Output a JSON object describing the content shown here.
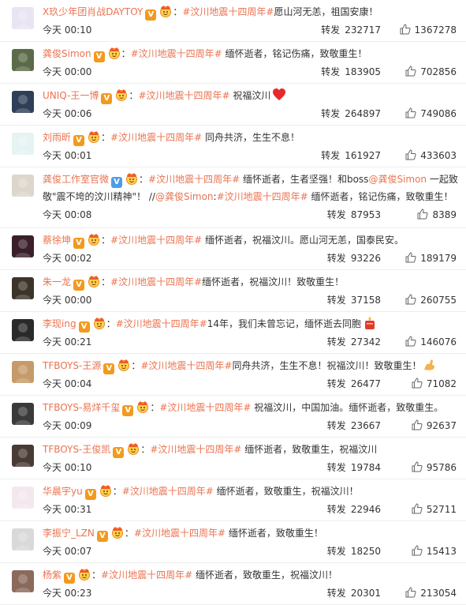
{
  "labels": {
    "repost": "转发"
  },
  "posts": [
    {
      "username": "X玖少年团肖战DAYTOY",
      "verified": "orange",
      "crown": true,
      "colon": "：",
      "lines": [
        [
          {
            "t": "tag",
            "v": "#汶川地震十四周年#"
          },
          {
            "t": "txt",
            "v": "愿山河无恙，祖国安康！"
          }
        ]
      ],
      "time": "今天 00:10",
      "reposts": "232717",
      "likes": "1367278",
      "avatar_color": "#e9e4f2"
    },
    {
      "username": "龚俊Simon",
      "verified": "orange",
      "crown": true,
      "colon": "：",
      "lines": [
        [
          {
            "t": "tag",
            "v": "#汶川地震十四周年#"
          },
          {
            "t": "txt",
            "v": " 缅怀逝者，铭记伤痛，致敬重生！"
          }
        ]
      ],
      "time": "今天 00:00",
      "reposts": "183905",
      "likes": "702856",
      "avatar_color": "#5b6b4a"
    },
    {
      "username": "UNIQ-王一博",
      "verified": "orange",
      "crown": true,
      "colon": "：",
      "lines": [
        [
          {
            "t": "tag",
            "v": "#汶川地震十四周年#"
          },
          {
            "t": "txt",
            "v": " 祝福汶川"
          },
          {
            "t": "emoji",
            "v": "red-heart-icon"
          }
        ]
      ],
      "time": "今天 00:06",
      "reposts": "264897",
      "likes": "749086",
      "avatar_color": "#2f3f58"
    },
    {
      "username": "刘雨昕",
      "verified": "orange",
      "crown": true,
      "colon": "：",
      "lines": [
        [
          {
            "t": "tag",
            "v": "#汶川地震十四周年#"
          },
          {
            "t": "txt",
            "v": " 同舟共济，生生不息！"
          }
        ]
      ],
      "time": "今天 00:01",
      "reposts": "161927",
      "likes": "433603",
      "avatar_color": "#e6f3f3"
    },
    {
      "username": "龚俊工作室官微",
      "verified": "blue",
      "crown": true,
      "colon": "：",
      "lines": [
        [
          {
            "t": "tag",
            "v": "#汶川地震十四周年#"
          },
          {
            "t": "txt",
            "v": " 缅怀逝者，生者坚强！和boss"
          },
          {
            "t": "mention",
            "v": "@龚俊Simon"
          },
          {
            "t": "txt",
            "v": " 一起致"
          }
        ],
        [
          {
            "t": "txt",
            "v": "敬\"震不垮的汶川精神\"！ //"
          },
          {
            "t": "mention",
            "v": "@龚俊Simon"
          },
          {
            "t": "txt",
            "v": ":"
          },
          {
            "t": "tag",
            "v": "#汶川地震十四周年#"
          },
          {
            "t": "txt",
            "v": " 缅怀逝者，铭记伤痛，致敬重生！"
          }
        ]
      ],
      "time": "今天 00:08",
      "reposts": "87953",
      "likes": "8389",
      "avatar_color": "#ddd6cc"
    },
    {
      "username": "蔡徐坤",
      "verified": "orange",
      "crown": true,
      "colon": "：",
      "lines": [
        [
          {
            "t": "tag",
            "v": "#汶川地震十四周年#"
          },
          {
            "t": "txt",
            "v": " 缅怀逝者，祝福汶川。愿山河无恙，国泰民安。"
          }
        ]
      ],
      "time": "今天 00:02",
      "reposts": "93226",
      "likes": "189179",
      "avatar_color": "#3b1f2a"
    },
    {
      "username": "朱一龙",
      "verified": "orange",
      "crown": true,
      "colon": "：",
      "lines": [
        [
          {
            "t": "tag",
            "v": "#汶川地震十四周年#"
          },
          {
            "t": "txt",
            "v": "缅怀逝者，祝福汶川！致敬重生！"
          }
        ]
      ],
      "time": "今天 00:00",
      "reposts": "37158",
      "likes": "260755",
      "avatar_color": "#3c3428"
    },
    {
      "username": "李现ing",
      "verified": "orange",
      "crown": true,
      "colon": "：",
      "lines": [
        [
          {
            "t": "tag",
            "v": "#汶川地震十四周年#"
          },
          {
            "t": "txt",
            "v": "14年，我们未曾忘记，缅怀逝去同胞"
          },
          {
            "t": "emoji",
            "v": "candle-icon"
          }
        ]
      ],
      "time": "今天 00:21",
      "reposts": "27342",
      "likes": "146076",
      "avatar_color": "#2a2a2a"
    },
    {
      "username": "TFBOYS-王源",
      "verified": "orange",
      "crown": true,
      "colon": "：",
      "lines": [
        [
          {
            "t": "tag",
            "v": "#汶川地震十四周年#"
          },
          {
            "t": "txt",
            "v": "同舟共济，生生不息！祝福汶川！致敬重生！"
          },
          {
            "t": "emoji",
            "v": "flexed-arm-icon"
          }
        ]
      ],
      "time": "今天 00:04",
      "reposts": "26477",
      "likes": "71082",
      "avatar_color": "#c69a6a"
    },
    {
      "username": "TFBOYS-易烊千玺",
      "verified": "orange",
      "crown": true,
      "colon": "：",
      "lines": [
        [
          {
            "t": "tag",
            "v": "#汶川地震十四周年#"
          },
          {
            "t": "txt",
            "v": " 祝福汶川，中国加油。缅怀逝者，致敬重生。"
          }
        ]
      ],
      "time": "今天 00:09",
      "reposts": "23667",
      "likes": "92637",
      "avatar_color": "#3a3a3a"
    },
    {
      "username": "TFBOYS-王俊凯",
      "verified": "orange",
      "crown": true,
      "colon": "：",
      "lines": [
        [
          {
            "t": "tag",
            "v": "#汶川地震十四周年#"
          },
          {
            "t": "txt",
            "v": " 缅怀逝者，致敬重生，祝福汶川"
          }
        ]
      ],
      "time": "今天 00:10",
      "reposts": "19784",
      "likes": "95786",
      "avatar_color": "#4a3a35"
    },
    {
      "username": "华晨宇yu",
      "verified": "orange",
      "crown": true,
      "colon": "：",
      "lines": [
        [
          {
            "t": "tag",
            "v": "#汶川地震十四周年#"
          },
          {
            "t": "txt",
            "v": " 缅怀逝者，致敬重生，祝福汶川！"
          }
        ]
      ],
      "time": "今天 00:31",
      "reposts": "22946",
      "likes": "52711",
      "avatar_color": "#f2e8ee"
    },
    {
      "username": "李振宁_LZN",
      "verified": "orange",
      "crown": true,
      "colon": "：",
      "lines": [
        [
          {
            "t": "tag",
            "v": "#汶川地震十四周年#"
          },
          {
            "t": "txt",
            "v": " 缅怀逝者，致敬重生！"
          }
        ]
      ],
      "time": "今天 00:07",
      "reposts": "18250",
      "likes": "15413",
      "avatar_color": "#d9d9d9"
    },
    {
      "username": "杨紫",
      "verified": "orange",
      "crown": true,
      "colon": "：",
      "lines": [
        [
          {
            "t": "tag",
            "v": "#汶川地震十四周年#"
          },
          {
            "t": "txt",
            "v": " 缅怀逝者，致敬重生，祝福汶川！"
          }
        ]
      ],
      "time": "今天 00:23",
      "reposts": "20301",
      "likes": "213054",
      "avatar_color": "#8a6a5a"
    }
  ]
}
